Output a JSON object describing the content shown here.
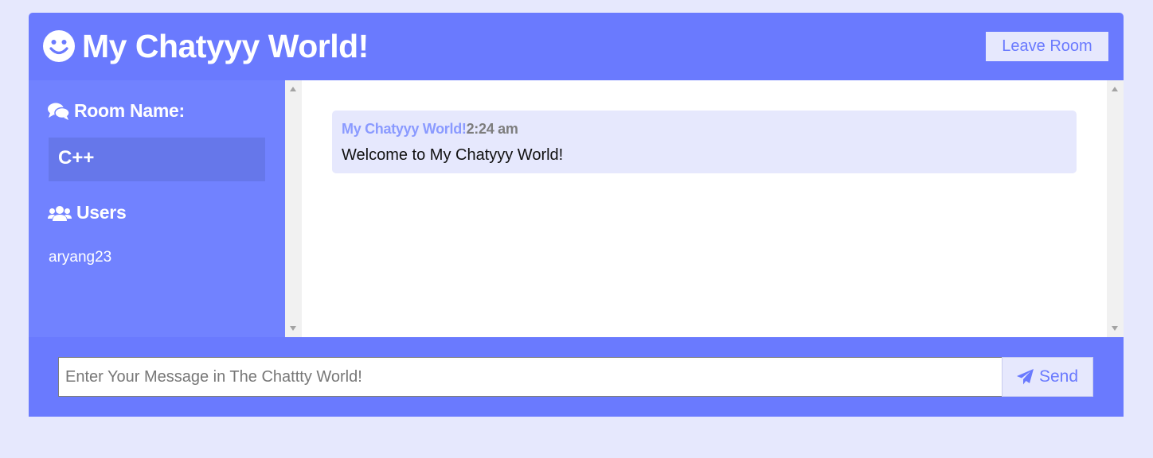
{
  "header": {
    "title": "My Chatyyy World!",
    "leave_label": "Leave Room",
    "icon": "smile-icon"
  },
  "sidebar": {
    "room_heading": "Room Name:",
    "room_name": "C++",
    "users_heading": "Users",
    "users": [
      "aryang23"
    ]
  },
  "messages": [
    {
      "username": "My Chatyyy World!",
      "time": "2:24 am",
      "text": "Welcome to My Chatyyy World!"
    }
  ],
  "form": {
    "placeholder": "Enter Your Message in The Chattty World!",
    "send_label": "Send"
  },
  "colors": {
    "page_bg": "#e6e8fd",
    "header_bg": "#6a7afe",
    "sidebar_bg": "#7182ff",
    "room_box_bg": "#6677ea",
    "message_bg": "#e6e8fd",
    "username_color": "#8a9aff"
  }
}
